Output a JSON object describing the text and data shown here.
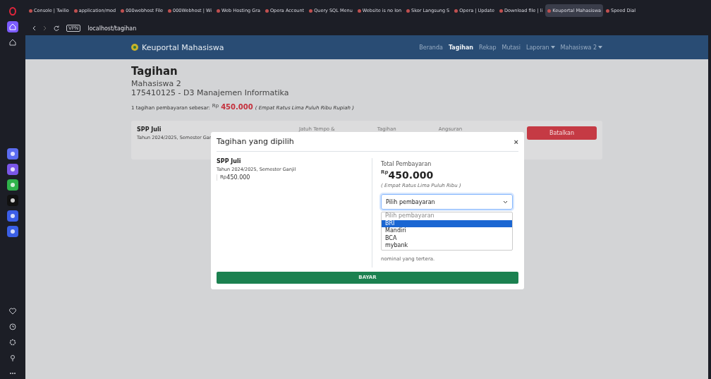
{
  "browser": {
    "tabs": [
      {
        "label": "Console | Twilio",
        "selected": false
      },
      {
        "label": "application/mod",
        "selected": false
      },
      {
        "label": "000webhost File",
        "selected": false
      },
      {
        "label": "000Webhost | Wi",
        "selected": false
      },
      {
        "label": "Web Hosting Gra",
        "selected": false
      },
      {
        "label": "Opera Account",
        "selected": false
      },
      {
        "label": "Query SQL Menu",
        "selected": false
      },
      {
        "label": "Website is no lon",
        "selected": false
      },
      {
        "label": "Skor Langsung S",
        "selected": false
      },
      {
        "label": "Opera | Update",
        "selected": false
      },
      {
        "label": "Download file | li",
        "selected": false
      },
      {
        "label": "Keuportal Mahasiswa",
        "selected": true
      },
      {
        "label": "Speed Dial",
        "selected": false
      }
    ],
    "url": "localhost/tagihan",
    "vpn_badge": "VPN"
  },
  "navbar": {
    "brand": "Keuportal Mahasiswa",
    "links": [
      {
        "label": "Beranda",
        "selected": false,
        "dropdown": false
      },
      {
        "label": "Tagihan",
        "selected": true,
        "dropdown": false
      },
      {
        "label": "Rekap",
        "selected": false,
        "dropdown": false
      },
      {
        "label": "Mutasi",
        "selected": false,
        "dropdown": false
      },
      {
        "label": "Laporan",
        "selected": false,
        "dropdown": true
      },
      {
        "label": "Mahasiswa 2",
        "selected": false,
        "dropdown": true
      }
    ]
  },
  "page": {
    "title": "Tagihan",
    "student_name": "Mahasiswa 2",
    "student_id": "175410125 - D3 Manajemen Informatika",
    "summary_label": "1 tagihan pembayaran sebesar:",
    "currency": "Rp",
    "summary_amount": "450.000",
    "summary_words": "( Empat Ratus Lima Puluh Ribu Rupiah )"
  },
  "bill_card": {
    "name": "SPP Juli",
    "period": "Tahun 2024/2025, Semester Gan",
    "columns": [
      "Jatuh Tempo &",
      "Tagihan",
      "Angsuran"
    ],
    "cancel_button": "Batalkan"
  },
  "modal": {
    "title": "Tagihan yang dipilih",
    "close": "×",
    "item_name": "SPP Juli",
    "item_period": "Tahun 2024/2025, Semester Ganjil",
    "item_currency": "Rp",
    "item_amount": "450.000",
    "total_label": "Total Pembayaran",
    "total_currency": "Rp",
    "total_amount": "450.000",
    "total_words": "( Empat Ratus Lima Puluh Ribu )",
    "select": {
      "value": "Pilih pembayaran",
      "options": [
        {
          "label": "Pilih pembayaran",
          "highlighted": false,
          "kind": "placeholder"
        },
        {
          "label": "BRI",
          "highlighted": true,
          "kind": "option"
        },
        {
          "label": "Mandiri",
          "highlighted": false,
          "kind": "option"
        },
        {
          "label": "BCA",
          "highlighted": false,
          "kind": "option"
        },
        {
          "label": "mybank",
          "highlighted": false,
          "kind": "option"
        }
      ]
    },
    "note": "nominal yang tertera.",
    "pay_button": "BAYAR"
  }
}
